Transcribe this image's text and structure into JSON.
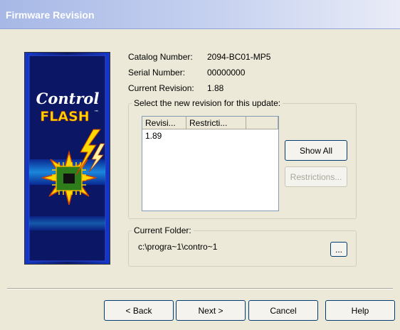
{
  "window": {
    "title": "Firmware Revision"
  },
  "banner": {
    "line1": "Control",
    "line2": "FLASH",
    "tm": "™"
  },
  "info": {
    "catalog_label": "Catalog Number:",
    "catalog_value": "2094-BC01-MP5",
    "serial_label": "Serial Number:",
    "serial_value": "00000000",
    "current_label": "Current Revision:",
    "current_value": "1.88"
  },
  "revision_group": {
    "legend": "Select the new revision for this update:",
    "columns": [
      "Revisi...",
      "Restricti...",
      ""
    ],
    "rows": [
      {
        "revision": "1.89",
        "restriction": ""
      }
    ],
    "show_all_label": "Show All",
    "restrictions_label": "Restrictions..."
  },
  "folder_group": {
    "legend": "Current Folder:",
    "path": "c:\\progra~1\\contro~1",
    "browse_label": "..."
  },
  "buttons": {
    "back": "< Back",
    "next": "Next >",
    "cancel": "Cancel",
    "help": "Help"
  },
  "colors": {
    "window_bg": "#ece9d8",
    "title_gradient_start": "#a7b8e6",
    "banner_bg": "#0b1a6d",
    "flash_yellow": "#ffd800"
  }
}
